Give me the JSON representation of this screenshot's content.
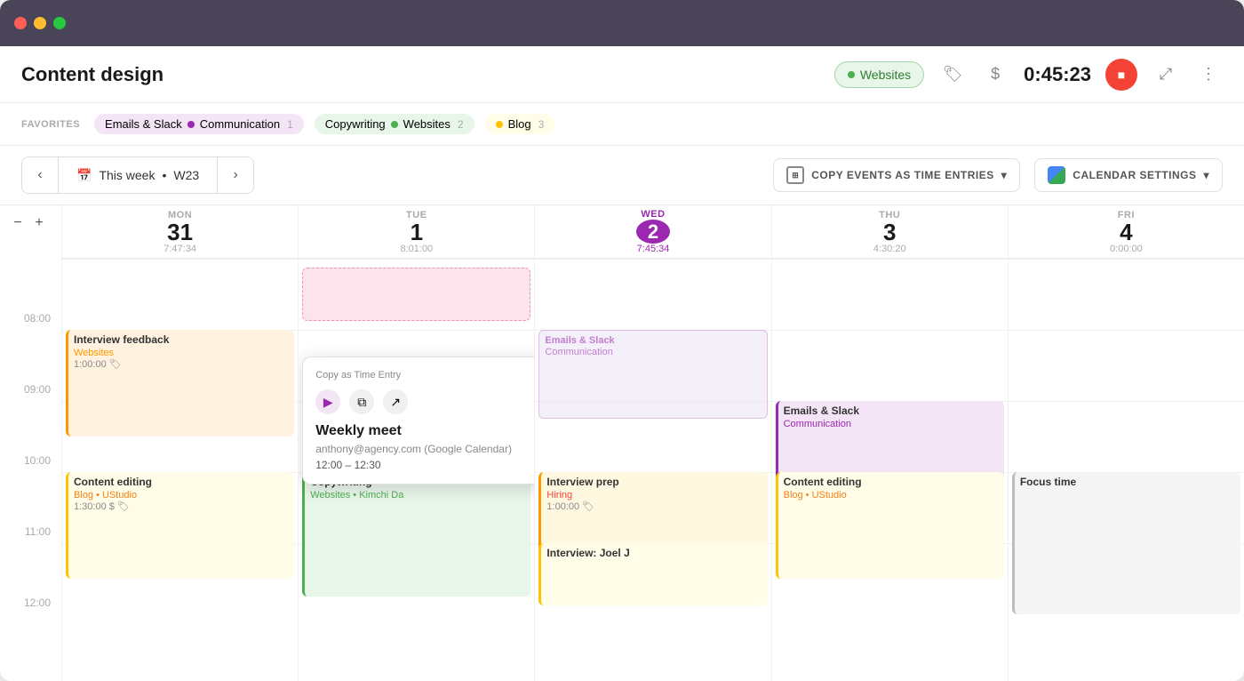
{
  "app": {
    "title": "Content design",
    "timer": "0:45:23",
    "project_badge": "Websites"
  },
  "titlebar": {
    "lights": [
      "red",
      "yellow",
      "green"
    ]
  },
  "favorites": {
    "label": "FAVORITES",
    "tabs": [
      {
        "name": "emails-slack-tab",
        "text": "Emails & Slack",
        "dot": "purple",
        "tag": "Communication",
        "count": "1",
        "active": true
      },
      {
        "name": "copywriting-tab",
        "text": "Copywriting",
        "dot": "green",
        "tag": "Websites",
        "count": "2",
        "active": false
      },
      {
        "name": "blog-tab",
        "text": "Blog",
        "dot": "yellow",
        "tag": "",
        "count": "3",
        "active": false
      }
    ]
  },
  "toolbar": {
    "prev_label": "‹",
    "next_label": "›",
    "week_label": "This week",
    "week_num": "W23",
    "copy_events_label": "COPY EVENTS AS TIME ENTRIES",
    "calendar_settings_label": "CALENDAR SETTINGS"
  },
  "days": [
    {
      "num": "31",
      "name": "MON",
      "time": "7:47:34",
      "today": false
    },
    {
      "num": "1",
      "name": "TUE",
      "time": "8:01:00",
      "today": false
    },
    {
      "num": "2",
      "name": "WED",
      "time": "7:45:34",
      "today": true
    },
    {
      "num": "3",
      "name": "THU",
      "time": "4:30:20",
      "today": false
    },
    {
      "num": "4",
      "name": "FRI",
      "time": "0:00:00",
      "today": false
    }
  ],
  "times": [
    "08:00",
    "09:00",
    "10:00",
    "11:00",
    "12:00"
  ],
  "popup": {
    "label": "Copy as Time Entry",
    "title": "Weekly meet",
    "source": "anthony@agency.com (Google Calendar)",
    "time": "12:00 – 12:30"
  }
}
